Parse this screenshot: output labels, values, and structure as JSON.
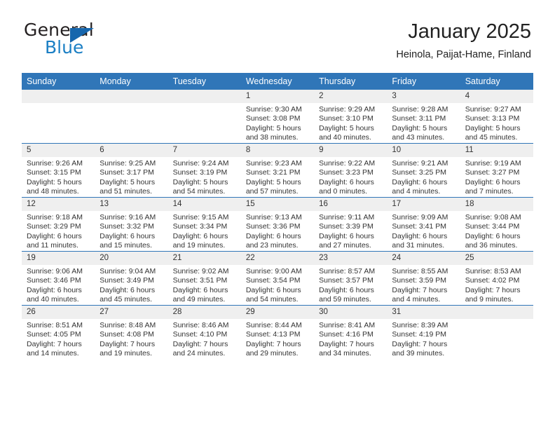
{
  "brand": {
    "name_part1": "General",
    "name_part2": "Blue",
    "accent_color": "#1666ad",
    "triangle_icon": "triangle-icon"
  },
  "header": {
    "title": "January 2025",
    "location": "Heinola, Paijat-Hame, Finland"
  },
  "calendar": {
    "header_bg": "#3076b8",
    "daynum_bg": "#efefef",
    "weekday_headers": [
      "Sunday",
      "Monday",
      "Tuesday",
      "Wednesday",
      "Thursday",
      "Friday",
      "Saturday"
    ],
    "weeks": [
      [
        {
          "day": "",
          "empty": true,
          "sunrise": "",
          "sunset": "",
          "daylight1": "",
          "daylight2": ""
        },
        {
          "day": "",
          "empty": true,
          "sunrise": "",
          "sunset": "",
          "daylight1": "",
          "daylight2": ""
        },
        {
          "day": "",
          "empty": true,
          "sunrise": "",
          "sunset": "",
          "daylight1": "",
          "daylight2": ""
        },
        {
          "day": "1",
          "sunrise": "Sunrise: 9:30 AM",
          "sunset": "Sunset: 3:08 PM",
          "daylight1": "Daylight: 5 hours",
          "daylight2": "and 38 minutes."
        },
        {
          "day": "2",
          "sunrise": "Sunrise: 9:29 AM",
          "sunset": "Sunset: 3:10 PM",
          "daylight1": "Daylight: 5 hours",
          "daylight2": "and 40 minutes."
        },
        {
          "day": "3",
          "sunrise": "Sunrise: 9:28 AM",
          "sunset": "Sunset: 3:11 PM",
          "daylight1": "Daylight: 5 hours",
          "daylight2": "and 43 minutes."
        },
        {
          "day": "4",
          "sunrise": "Sunrise: 9:27 AM",
          "sunset": "Sunset: 3:13 PM",
          "daylight1": "Daylight: 5 hours",
          "daylight2": "and 45 minutes."
        }
      ],
      [
        {
          "day": "5",
          "sunrise": "Sunrise: 9:26 AM",
          "sunset": "Sunset: 3:15 PM",
          "daylight1": "Daylight: 5 hours",
          "daylight2": "and 48 minutes."
        },
        {
          "day": "6",
          "sunrise": "Sunrise: 9:25 AM",
          "sunset": "Sunset: 3:17 PM",
          "daylight1": "Daylight: 5 hours",
          "daylight2": "and 51 minutes."
        },
        {
          "day": "7",
          "sunrise": "Sunrise: 9:24 AM",
          "sunset": "Sunset: 3:19 PM",
          "daylight1": "Daylight: 5 hours",
          "daylight2": "and 54 minutes."
        },
        {
          "day": "8",
          "sunrise": "Sunrise: 9:23 AM",
          "sunset": "Sunset: 3:21 PM",
          "daylight1": "Daylight: 5 hours",
          "daylight2": "and 57 minutes."
        },
        {
          "day": "9",
          "sunrise": "Sunrise: 9:22 AM",
          "sunset": "Sunset: 3:23 PM",
          "daylight1": "Daylight: 6 hours",
          "daylight2": "and 0 minutes."
        },
        {
          "day": "10",
          "sunrise": "Sunrise: 9:21 AM",
          "sunset": "Sunset: 3:25 PM",
          "daylight1": "Daylight: 6 hours",
          "daylight2": "and 4 minutes."
        },
        {
          "day": "11",
          "sunrise": "Sunrise: 9:19 AM",
          "sunset": "Sunset: 3:27 PM",
          "daylight1": "Daylight: 6 hours",
          "daylight2": "and 7 minutes."
        }
      ],
      [
        {
          "day": "12",
          "sunrise": "Sunrise: 9:18 AM",
          "sunset": "Sunset: 3:29 PM",
          "daylight1": "Daylight: 6 hours",
          "daylight2": "and 11 minutes."
        },
        {
          "day": "13",
          "sunrise": "Sunrise: 9:16 AM",
          "sunset": "Sunset: 3:32 PM",
          "daylight1": "Daylight: 6 hours",
          "daylight2": "and 15 minutes."
        },
        {
          "day": "14",
          "sunrise": "Sunrise: 9:15 AM",
          "sunset": "Sunset: 3:34 PM",
          "daylight1": "Daylight: 6 hours",
          "daylight2": "and 19 minutes."
        },
        {
          "day": "15",
          "sunrise": "Sunrise: 9:13 AM",
          "sunset": "Sunset: 3:36 PM",
          "daylight1": "Daylight: 6 hours",
          "daylight2": "and 23 minutes."
        },
        {
          "day": "16",
          "sunrise": "Sunrise: 9:11 AM",
          "sunset": "Sunset: 3:39 PM",
          "daylight1": "Daylight: 6 hours",
          "daylight2": "and 27 minutes."
        },
        {
          "day": "17",
          "sunrise": "Sunrise: 9:09 AM",
          "sunset": "Sunset: 3:41 PM",
          "daylight1": "Daylight: 6 hours",
          "daylight2": "and 31 minutes."
        },
        {
          "day": "18",
          "sunrise": "Sunrise: 9:08 AM",
          "sunset": "Sunset: 3:44 PM",
          "daylight1": "Daylight: 6 hours",
          "daylight2": "and 36 minutes."
        }
      ],
      [
        {
          "day": "19",
          "sunrise": "Sunrise: 9:06 AM",
          "sunset": "Sunset: 3:46 PM",
          "daylight1": "Daylight: 6 hours",
          "daylight2": "and 40 minutes."
        },
        {
          "day": "20",
          "sunrise": "Sunrise: 9:04 AM",
          "sunset": "Sunset: 3:49 PM",
          "daylight1": "Daylight: 6 hours",
          "daylight2": "and 45 minutes."
        },
        {
          "day": "21",
          "sunrise": "Sunrise: 9:02 AM",
          "sunset": "Sunset: 3:51 PM",
          "daylight1": "Daylight: 6 hours",
          "daylight2": "and 49 minutes."
        },
        {
          "day": "22",
          "sunrise": "Sunrise: 9:00 AM",
          "sunset": "Sunset: 3:54 PM",
          "daylight1": "Daylight: 6 hours",
          "daylight2": "and 54 minutes."
        },
        {
          "day": "23",
          "sunrise": "Sunrise: 8:57 AM",
          "sunset": "Sunset: 3:57 PM",
          "daylight1": "Daylight: 6 hours",
          "daylight2": "and 59 minutes."
        },
        {
          "day": "24",
          "sunrise": "Sunrise: 8:55 AM",
          "sunset": "Sunset: 3:59 PM",
          "daylight1": "Daylight: 7 hours",
          "daylight2": "and 4 minutes."
        },
        {
          "day": "25",
          "sunrise": "Sunrise: 8:53 AM",
          "sunset": "Sunset: 4:02 PM",
          "daylight1": "Daylight: 7 hours",
          "daylight2": "and 9 minutes."
        }
      ],
      [
        {
          "day": "26",
          "sunrise": "Sunrise: 8:51 AM",
          "sunset": "Sunset: 4:05 PM",
          "daylight1": "Daylight: 7 hours",
          "daylight2": "and 14 minutes."
        },
        {
          "day": "27",
          "sunrise": "Sunrise: 8:48 AM",
          "sunset": "Sunset: 4:08 PM",
          "daylight1": "Daylight: 7 hours",
          "daylight2": "and 19 minutes."
        },
        {
          "day": "28",
          "sunrise": "Sunrise: 8:46 AM",
          "sunset": "Sunset: 4:10 PM",
          "daylight1": "Daylight: 7 hours",
          "daylight2": "and 24 minutes."
        },
        {
          "day": "29",
          "sunrise": "Sunrise: 8:44 AM",
          "sunset": "Sunset: 4:13 PM",
          "daylight1": "Daylight: 7 hours",
          "daylight2": "and 29 minutes."
        },
        {
          "day": "30",
          "sunrise": "Sunrise: 8:41 AM",
          "sunset": "Sunset: 4:16 PM",
          "daylight1": "Daylight: 7 hours",
          "daylight2": "and 34 minutes."
        },
        {
          "day": "31",
          "sunrise": "Sunrise: 8:39 AM",
          "sunset": "Sunset: 4:19 PM",
          "daylight1": "Daylight: 7 hours",
          "daylight2": "and 39 minutes."
        },
        {
          "day": "",
          "empty": true,
          "sunrise": "",
          "sunset": "",
          "daylight1": "",
          "daylight2": ""
        }
      ]
    ]
  }
}
